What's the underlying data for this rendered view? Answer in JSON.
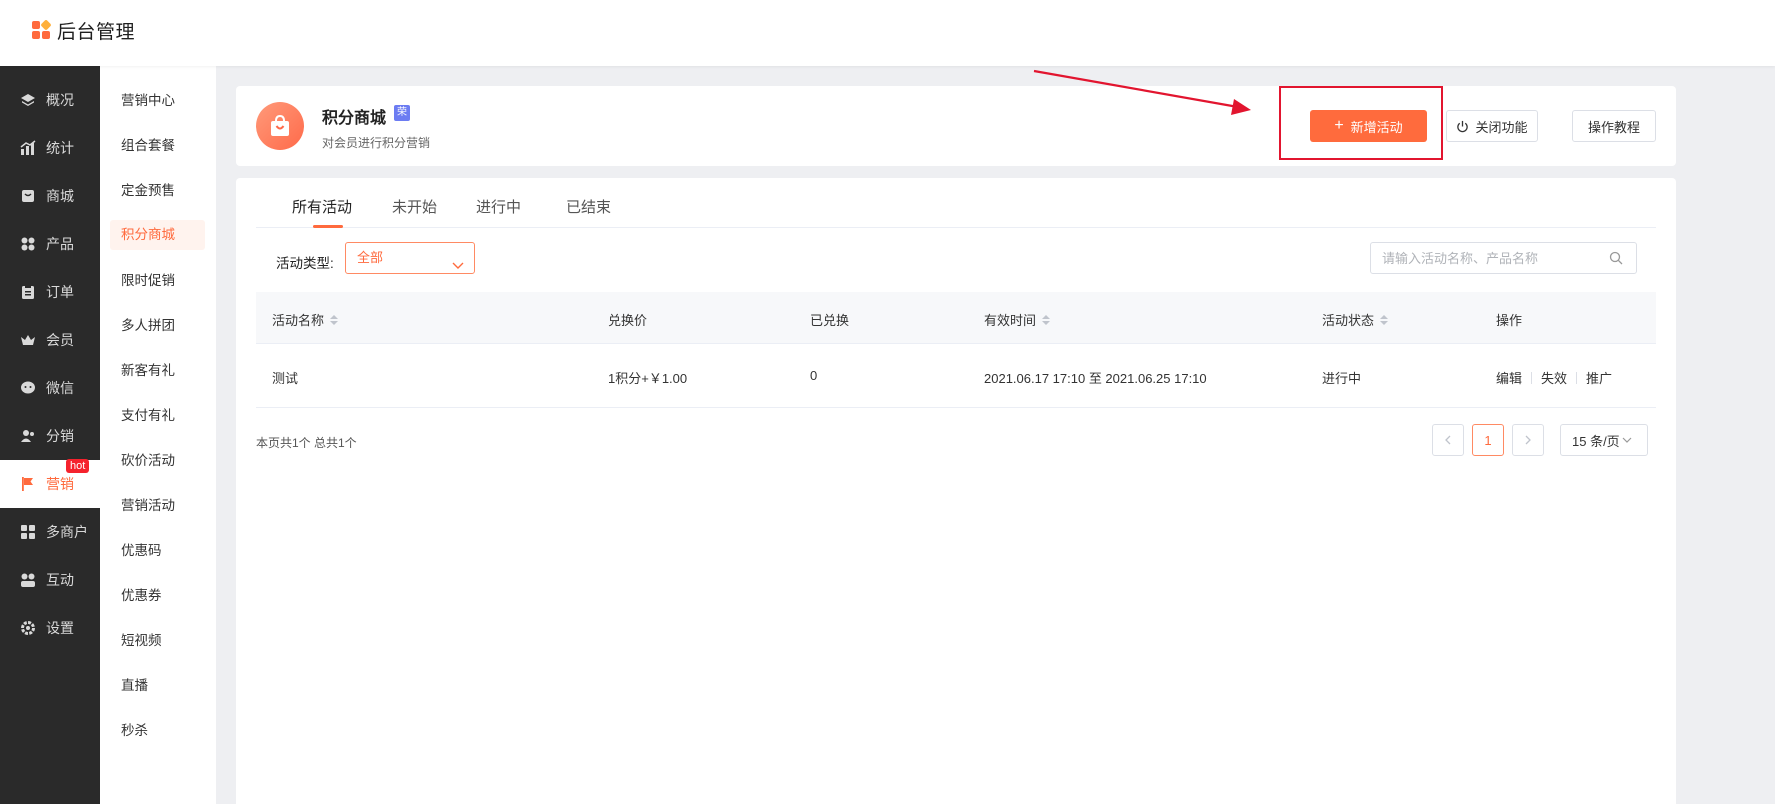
{
  "header": {
    "title": "后台管理"
  },
  "sidebar": {
    "items": [
      {
        "label": "概况",
        "icon": "layers-icon"
      },
      {
        "label": "统计",
        "icon": "chart-icon"
      },
      {
        "label": "商城",
        "icon": "store-icon"
      },
      {
        "label": "产品",
        "icon": "grid-icon"
      },
      {
        "label": "订单",
        "icon": "clipboard-icon"
      },
      {
        "label": "会员",
        "icon": "crown-icon"
      },
      {
        "label": "微信",
        "icon": "wechat-icon"
      },
      {
        "label": "分销",
        "icon": "users-icon"
      },
      {
        "label": "营销",
        "icon": "flag-icon",
        "active": true,
        "badge": "hot"
      },
      {
        "label": "多商户",
        "icon": "shop-icon"
      },
      {
        "label": "互动",
        "icon": "interact-icon"
      },
      {
        "label": "设置",
        "icon": "gear-icon"
      }
    ]
  },
  "submenu": {
    "items": [
      "营销中心",
      "组合套餐",
      "定金预售",
      "积分商城",
      "限时促销",
      "多人拼团",
      "新客有礼",
      "支付有礼",
      "砍价活动",
      "营销活动",
      "优惠码",
      "优惠券",
      "短视频",
      "直播",
      "秒杀"
    ],
    "active_index": 3
  },
  "app": {
    "title": "积分商城",
    "tag": "荣",
    "description": "对会员进行积分营销",
    "add_button": "新增活动",
    "close_button": "关闭功能",
    "tutorial_button": "操作教程"
  },
  "tabs": [
    "所有活动",
    "未开始",
    "进行中",
    "已结束"
  ],
  "filter": {
    "label": "活动类型:",
    "selected": "全部",
    "search_placeholder": "请输入活动名称、产品名称"
  },
  "table": {
    "columns": [
      "活动名称",
      "兑换价",
      "已兑换",
      "有效时间",
      "活动状态",
      "操作"
    ],
    "rows": [
      {
        "name": "测试",
        "price": "1积分+￥1.00",
        "redeemed": "0",
        "period": "2021.06.17 17:10 至 2021.06.25 17:10",
        "status": "进行中",
        "actions": [
          "编辑",
          "失效",
          "推广"
        ]
      }
    ]
  },
  "pagination": {
    "summary": "本页共1个 总共1个",
    "current_page": "1",
    "page_size": "15 条/页"
  },
  "colors": {
    "accent": "#ff6a3d",
    "highlight": "#e2152f",
    "sidebar_bg": "#2a2a2a"
  }
}
